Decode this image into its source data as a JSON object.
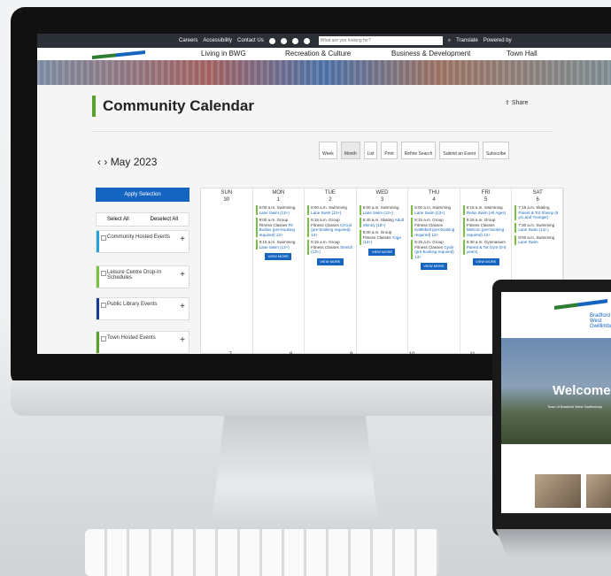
{
  "topbar": {
    "links": [
      "Careers",
      "Accessibility",
      "Contact Us"
    ],
    "search_placeholder": "What are you looking for?",
    "translate": "Translate",
    "powered": "Powered by"
  },
  "menu": {
    "items": [
      "Living in BWG",
      "Recreation & Culture",
      "Business & Development",
      "Town Hall"
    ],
    "logo_text": "Bradford West Gwillimbury"
  },
  "page": {
    "title": "Community Calendar",
    "share": "Share",
    "month": "May 2023"
  },
  "toolbar": {
    "week": "Week",
    "month": "Month",
    "list": "List",
    "print": "Print",
    "refine": "Refine Search",
    "submit": "Submit an Event",
    "subscribe": "Subscribe"
  },
  "sidebar": {
    "apply": "Apply Selection",
    "select_all": "Select All",
    "deselect_all": "Deselect All",
    "filters": [
      {
        "label": "Community Hosted Events",
        "color": "#29a3d6"
      },
      {
        "label": "Leisure Centre Drop-In Schedules",
        "color": "#7ac143"
      },
      {
        "label": "Public Library Events",
        "color": "#1a3c8c"
      },
      {
        "label": "Town Hosted Events",
        "color": "#5aa02c"
      }
    ]
  },
  "calendar": {
    "days": [
      {
        "name": "SUN",
        "num": "30",
        "events": []
      },
      {
        "name": "MON",
        "num": "1",
        "events": [
          [
            "6:00 a.m. Swimming",
            "Lane Swim (13+)"
          ],
          [
            "9:00 a.m. Group Fitness Classes",
            "Fit Bodies (pre-booking required) 13+"
          ],
          [
            "9:15 a.m. Swimming",
            "Lane Swim (13+)"
          ]
        ]
      },
      {
        "name": "TUE",
        "num": "2",
        "events": [
          [
            "6:00 a.m. Swimming",
            "Lane Swim (13+)"
          ],
          [
            "8:15 a.m. Group Fitness Classes",
            "Circuit (pre-booking required) 13+"
          ],
          [
            "9:15 a.m. Group Fitness Classes",
            "Stretch (13+)"
          ]
        ]
      },
      {
        "name": "WED",
        "num": "3",
        "events": [
          [
            "6:00 a.m. Swimming",
            "Lane Swim (13+)"
          ],
          [
            "6:40 a.m. Skating",
            "Adult Shinny (18+)"
          ],
          [
            "9:00 a.m. Group Fitness Classes",
            "Yoga (13+)"
          ]
        ]
      },
      {
        "name": "THU",
        "num": "4",
        "events": [
          [
            "6:00 a.m. Swimming",
            "Lane Swim (13+)"
          ],
          [
            "8:15 a.m. Group Fitness Classes",
            "Kettlebell (pre-booking required) 13+"
          ],
          [
            "9:15 a.m. Group Fitness Classes",
            "Cycle (pre-booking required) 13+"
          ]
        ]
      },
      {
        "name": "FRI",
        "num": "5",
        "events": [
          [
            "9:15 a.m. Swimming",
            "Relax Swim (All Ages)"
          ],
          [
            "9:15 a.m. Group Fitness Classes",
            "MetCon (pre-booking required) 13+"
          ],
          [
            "9:30 a.m. Gymnasium",
            "Parent & Tot Gym (0-5 years)"
          ]
        ]
      },
      {
        "name": "SAT",
        "num": "6",
        "events": [
          [
            "7:15 a.m. Skating",
            "Parent & Tot Shinny (6 y/o and Younger)"
          ],
          [
            "7:30 a.m. Swimming",
            "Lane Swim (13+)"
          ],
          [
            "8:00 a.m. Swimming",
            "Lane Swim"
          ]
        ]
      }
    ],
    "view_more": "VIEW MORE",
    "week2": [
      "7",
      "8",
      "9",
      "10",
      "11",
      "12"
    ]
  },
  "laptop": {
    "welcome": "Welcome",
    "subtitle": "Town of Bradford West Gwillimbury",
    "logo_text": "Bradford West Gwillimbury"
  }
}
